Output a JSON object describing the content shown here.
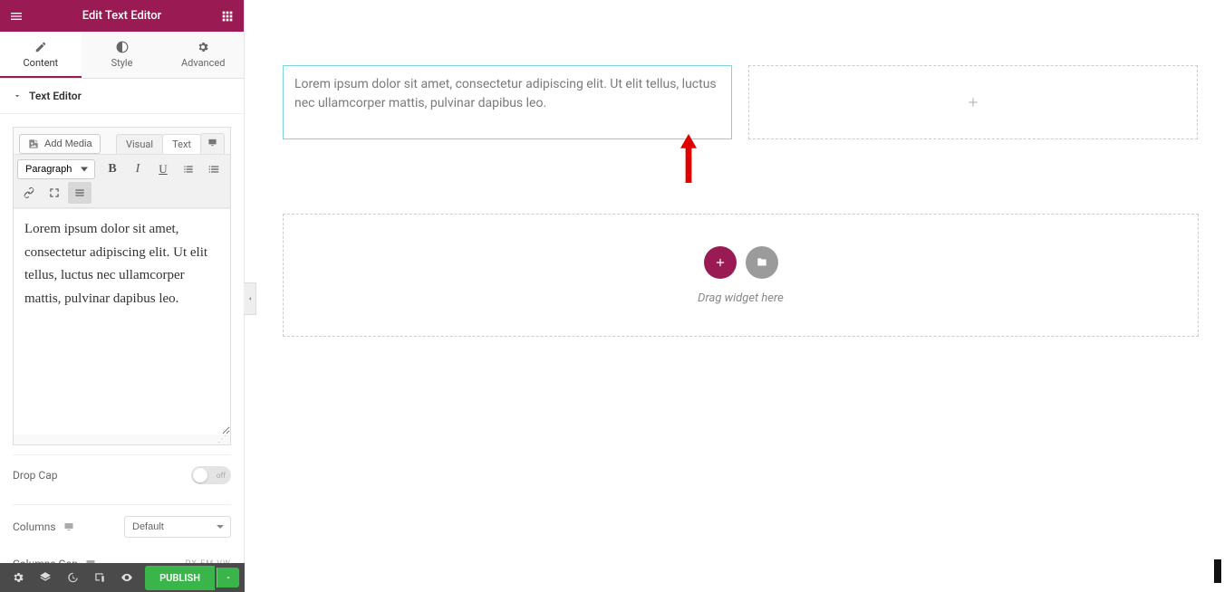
{
  "colors": {
    "brand": "#9a1a53",
    "publish": "#39b54a",
    "selection": "#7fd4dd",
    "arrow": "#e00000"
  },
  "header": {
    "title": "Edit Text Editor"
  },
  "tabs": {
    "content": "Content",
    "style": "Style",
    "advanced": "Advanced"
  },
  "section": {
    "text_editor": "Text Editor"
  },
  "editor": {
    "add_media": "Add Media",
    "tabs": {
      "visual": "Visual",
      "text": "Text"
    },
    "format": "Paragraph",
    "content": "Lorem ipsum dolor sit amet, consectetur adipiscing elit. Ut elit tellus, luctus nec ullamcorper mattis, pulvinar dapibus leo."
  },
  "controls": {
    "drop_cap": "Drop Cap",
    "columns": "Columns",
    "columns_value": "Default",
    "columns_gap": "Columns Gap",
    "units": "PX  EM  VW"
  },
  "footer": {
    "publish": "PUBLISH"
  },
  "canvas": {
    "text_widget": "Lorem ipsum dolor sit amet, consectetur adipiscing elit. Ut elit tellus, luctus nec ullamcorper mattis, pulvinar dapibus leo.",
    "drag_hint": "Drag widget here"
  }
}
